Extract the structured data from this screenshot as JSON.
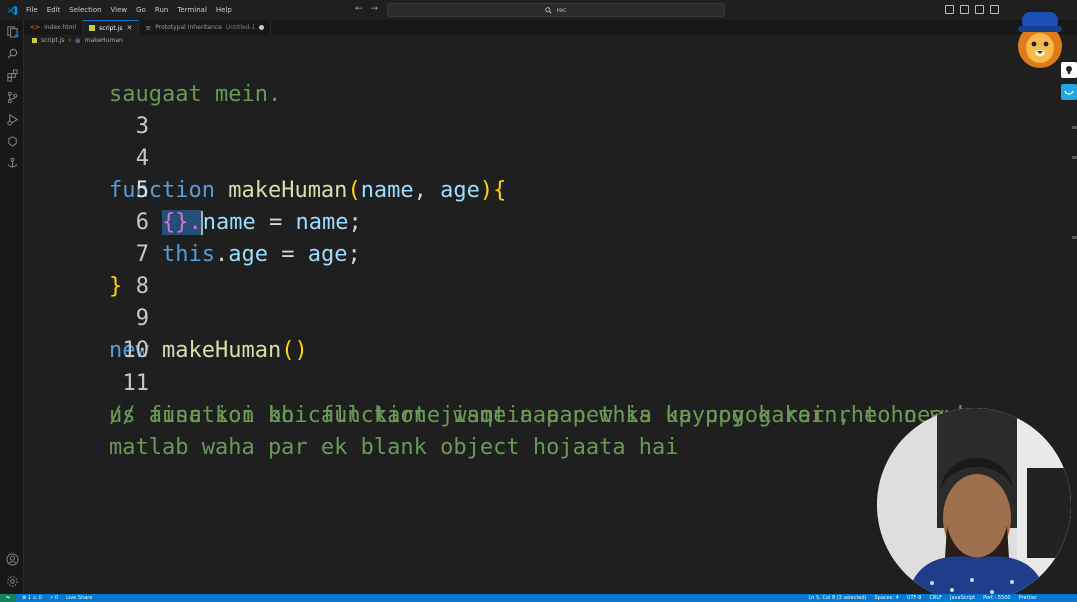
{
  "menu": [
    "File",
    "Edit",
    "Selection",
    "View",
    "Go",
    "Run",
    "Terminal",
    "Help"
  ],
  "search": {
    "text": "rec"
  },
  "tabs": [
    {
      "label": "index.html",
      "icon": "html-file-icon",
      "state": "inactive"
    },
    {
      "label": "script.js",
      "icon": "js-file-icon",
      "state": "active"
    },
    {
      "label": "Prototypal Inheritance",
      "suffix": "Untitled-1",
      "icon": "untitled-file-icon",
      "state": "modified"
    }
  ],
  "breadcrumb": {
    "file": "script.js",
    "symbol": "makeHuman"
  },
  "editor": {
    "lines": [
      {
        "num": "",
        "text": "saugaat mein."
      },
      {
        "num": "3"
      },
      {
        "num": "4"
      },
      {
        "num": "5"
      },
      {
        "num": "6"
      },
      {
        "num": "7"
      },
      {
        "num": "8"
      },
      {
        "num": "9"
      },
      {
        "num": "10"
      },
      {
        "num": "11",
        "comment": "// aisa koi bhi function jismein aap this ka upyog kar rhe ho aur"
      },
      {
        "num": "",
        "comment": "us function ko call karte waqt aap new ka upypog karein, to new ka"
      },
      {
        "num": "",
        "comment": "matlab waha par ek blank object hojaata hai"
      }
    ],
    "tokens": {
      "function": "function",
      "makeHuman": "makeHuman",
      "name": "name",
      "age": "age",
      "this": "this",
      "new": "new",
      "selection": "{}.",
      "name_rest": "name",
      "name_value": "name"
    }
  },
  "statusbar": {
    "left": [
      "⊗ 1 ⚠ 0",
      "⚡ 0",
      "Live Share"
    ],
    "right": [
      "Ln 5, Col 8 (3 selected)",
      "Spaces: 4",
      "UTF-8",
      "CRLF",
      "JavaScript",
      "Port : 5500",
      "Prettier"
    ]
  },
  "colors": {
    "keyword": "#569cd6",
    "function": "#dcdcaa",
    "parameter": "#9cdcfe",
    "comment": "#6a9955",
    "status": "#0078d4"
  }
}
